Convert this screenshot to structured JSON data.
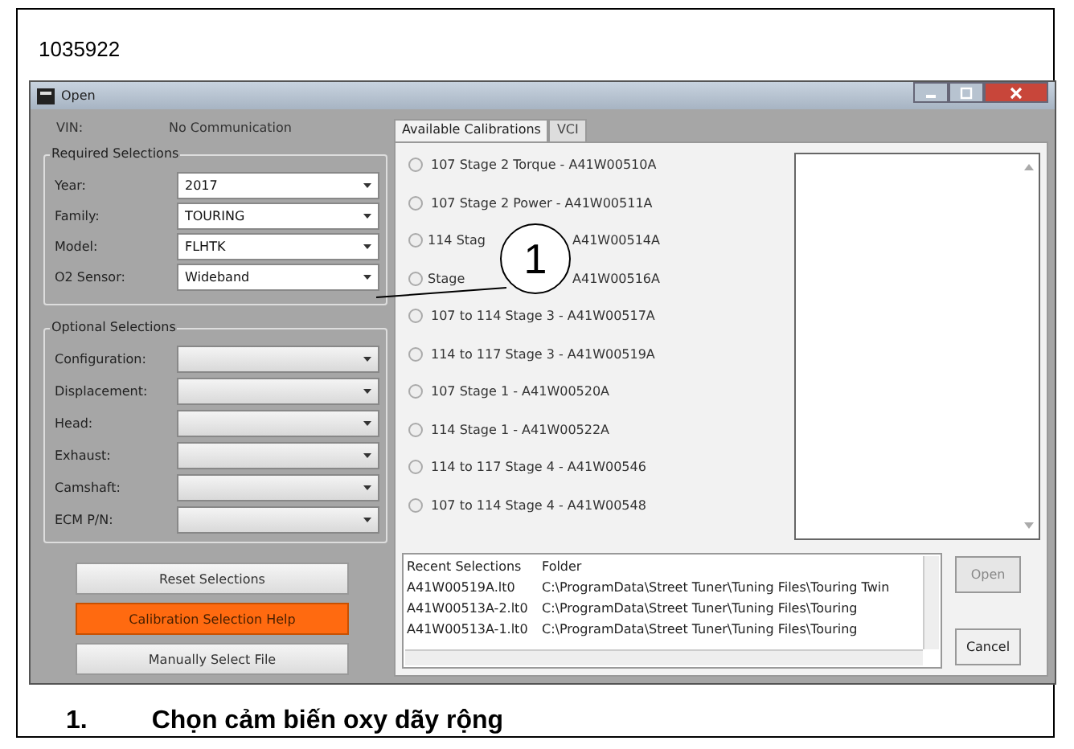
{
  "figure_id": "1035922",
  "window": {
    "title": "Open"
  },
  "vin": {
    "label": "VIN:",
    "value": "No Communication"
  },
  "required_selections": {
    "title": "Required Selections",
    "fields": [
      {
        "label": "Year:",
        "value": "2017"
      },
      {
        "label": "Family:",
        "value": "TOURING"
      },
      {
        "label": "Model:",
        "value": "FLHTK"
      },
      {
        "label": "O2 Sensor:",
        "value": "Wideband"
      }
    ]
  },
  "optional_selections": {
    "title": "Optional Selections",
    "fields": [
      {
        "label": "Configuration:"
      },
      {
        "label": "Displacement:"
      },
      {
        "label": "Head:"
      },
      {
        "label": "Exhaust:"
      },
      {
        "label": "Camshaft:"
      },
      {
        "label": "ECM P/N:"
      }
    ]
  },
  "buttons": [
    {
      "label": "Reset Selections",
      "kind": "normal"
    },
    {
      "label": "Calibration Selection Help",
      "kind": "highlight"
    },
    {
      "label": "Manually Select File",
      "kind": "normal"
    }
  ],
  "tabs": [
    {
      "label": "Available Calibrations",
      "selected": true
    },
    {
      "label": "VCI",
      "selected": false
    }
  ],
  "calibrations": [
    {
      "parts": [
        "107 Stage 2 Torque - A41W00510A"
      ],
      "selected": false
    },
    {
      "parts": [
        "107 Stage 2 Power - A41W00511A"
      ],
      "selected": false
    },
    {
      "parts": [
        "114 Stag",
        "A41W00514A"
      ],
      "selected": false
    },
    {
      "parts": [
        "Stage",
        "A41W00516A"
      ],
      "selected": false
    },
    {
      "parts": [
        "107 to 114 Stage 3 - A41W00517A"
      ],
      "selected": false
    },
    {
      "parts": [
        "114 to 117 Stage 3 - A41W00519A"
      ],
      "selected": false
    },
    {
      "parts": [
        "107 Stage 1 - A41W00520A"
      ],
      "selected": false
    },
    {
      "parts": [
        "114 Stage 1 - A41W00522A"
      ],
      "selected": false
    },
    {
      "parts": [
        "114 to 117 Stage 4 - A41W00546"
      ],
      "selected": false
    },
    {
      "parts": [
        "107 to 114 Stage 4 - A41W00548"
      ],
      "selected": false
    }
  ],
  "recent": {
    "columns": [
      "Recent Selections",
      "Folder"
    ],
    "rows": [
      [
        "A41W00519A.lt0",
        "C:\\ProgramData\\Street Tuner\\Tuning Files\\Touring Twin"
      ],
      [
        "A41W00513A-2.lt0",
        "C:\\ProgramData\\Street Tuner\\Tuning Files\\Touring"
      ],
      [
        "A41W00513A-1.lt0",
        "C:\\ProgramData\\Street Tuner\\Tuning Files\\Touring"
      ]
    ]
  },
  "actions": [
    {
      "label": "Open",
      "disabled": true
    },
    {
      "label": "Cancel",
      "disabled": false
    }
  ],
  "callout": {
    "number": "1"
  },
  "caption": {
    "number": "1.",
    "text": "Chọn cảm biến oxy dãy rộng"
  }
}
